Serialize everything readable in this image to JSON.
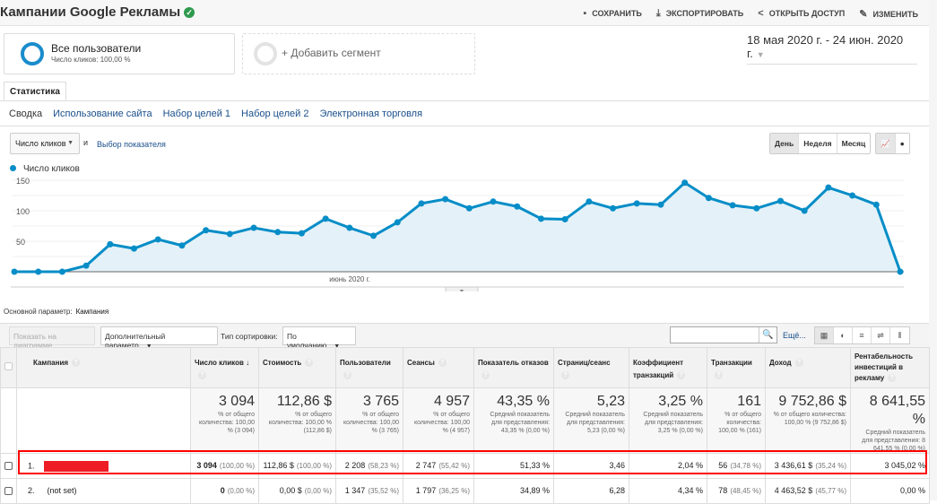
{
  "header": {
    "title": "Кампании Google Рекламы",
    "actions": [
      {
        "icon": "save-icon",
        "label": "СОХРАНИТЬ"
      },
      {
        "icon": "download-icon",
        "label": "ЭКСПОРТИРОВАТЬ"
      },
      {
        "icon": "share-icon",
        "label": "ОТКРЫТЬ ДОСТУП"
      },
      {
        "icon": "pencil-icon",
        "label": "ИЗМЕНИТЬ"
      }
    ]
  },
  "segments": {
    "active": {
      "name": "Все пользователи",
      "sub": "Число кликов: 100,00 %"
    },
    "add": "+ Добавить сегмент"
  },
  "date_range": "18 мая 2020 г. - 24 июн. 2020 г.",
  "tab": "Статистика",
  "subtabs": [
    "Сводка",
    "Использование сайта",
    "Набор целей 1",
    "Набор целей 2",
    "Электронная торговля"
  ],
  "metric_select": "Число кликов",
  "and_label": "и",
  "pick_metric": "Выбор показателя",
  "granularity": [
    "День",
    "Неделя",
    "Месяц"
  ],
  "chart_data": {
    "type": "area",
    "series": [
      {
        "name": "Число кликов",
        "color": "#058dc7",
        "values": [
          0,
          0,
          0,
          10,
          45,
          38,
          53,
          43,
          68,
          62,
          72,
          65,
          63,
          87,
          72,
          59,
          81,
          112,
          119,
          104,
          115,
          107,
          87,
          86,
          115,
          104,
          112,
          110,
          146,
          121,
          109,
          104,
          116,
          100,
          138,
          125,
          110,
          0
        ]
      }
    ],
    "y_ticks": [
      "50",
      "100",
      "150"
    ],
    "ylim": [
      0,
      175
    ],
    "x_label": "июнь 2020 г.",
    "grid": true
  },
  "primary_dim": {
    "label": "Основной параметр:",
    "value": "Кампания"
  },
  "toolbar": {
    "plot": "Показать на диаграмме",
    "secondary": "Дополнительный параметр",
    "sort_label": "Тип сортировки:",
    "sort_value": "По умолчанию",
    "more": "Ещё..."
  },
  "table": {
    "headers": [
      "Кампания",
      "Число кликов",
      "Стоимость",
      "Пользователи",
      "Сеансы",
      "Показатель отказов",
      "Страниц/сеанс",
      "Коэффициент транзакций",
      "Транзакции",
      "Доход",
      "Рентабельность инвестиций в рекламу"
    ],
    "totals": [
      {
        "big": "3 094",
        "sub": "% от общего количества: 100,00 % (3 094)"
      },
      {
        "big": "112,86 $",
        "sub": "% от общего количества: 100,00 % (112,86 $)"
      },
      {
        "big": "3 765",
        "sub": "% от общего количества: 100,00 % (3 765)"
      },
      {
        "big": "4 957",
        "sub": "% от общего количества: 100,00 % (4 957)"
      },
      {
        "big": "43,35 %",
        "sub": "Средний показатель для представления: 43,35 % (0,00 %)"
      },
      {
        "big": "5,23",
        "sub": "Средний показатель для представления: 5,23 (0,00 %)"
      },
      {
        "big": "3,25 %",
        "sub": "Средний показатель для представления: 3,25 % (0,00 %)"
      },
      {
        "big": "161",
        "sub": "% от общего количества: 100,00 % (161)"
      },
      {
        "big": "9 752,86 $",
        "sub": "% от общего количества: 100,00 % (9 752,86 $)"
      },
      {
        "big": "8 641,55 %",
        "sub": "Средний показатель для представления: 8 641,55 % (0,00 %)"
      }
    ],
    "rows": [
      {
        "index": "1.",
        "name": "",
        "cells": [
          [
            "3 094",
            "(100,00 %)"
          ],
          [
            "112,86 $",
            "(100,00 %)"
          ],
          [
            "2 208",
            "(58,23 %)"
          ],
          [
            "2 747",
            "(55,42 %)"
          ],
          [
            "51,33 %",
            ""
          ],
          [
            "3,46",
            ""
          ],
          [
            "2,04 %",
            ""
          ],
          [
            "56",
            "(34,78 %)"
          ],
          [
            "3 436,61 $",
            "(35,24 %)"
          ],
          [
            "3 045,02 %",
            ""
          ]
        ]
      },
      {
        "index": "2.",
        "name": "(not set)",
        "cells": [
          [
            "0",
            "(0,00 %)"
          ],
          [
            "0,00 $",
            "(0,00 %)"
          ],
          [
            "1 347",
            "(35,52 %)"
          ],
          [
            "1 797",
            "(36,25 %)"
          ],
          [
            "34,89 %",
            ""
          ],
          [
            "6,28",
            ""
          ],
          [
            "4,34 %",
            ""
          ],
          [
            "78",
            "(48,45 %)"
          ],
          [
            "4 463,52 $",
            "(45,77 %)"
          ],
          [
            "0,00 %",
            ""
          ]
        ]
      }
    ]
  }
}
